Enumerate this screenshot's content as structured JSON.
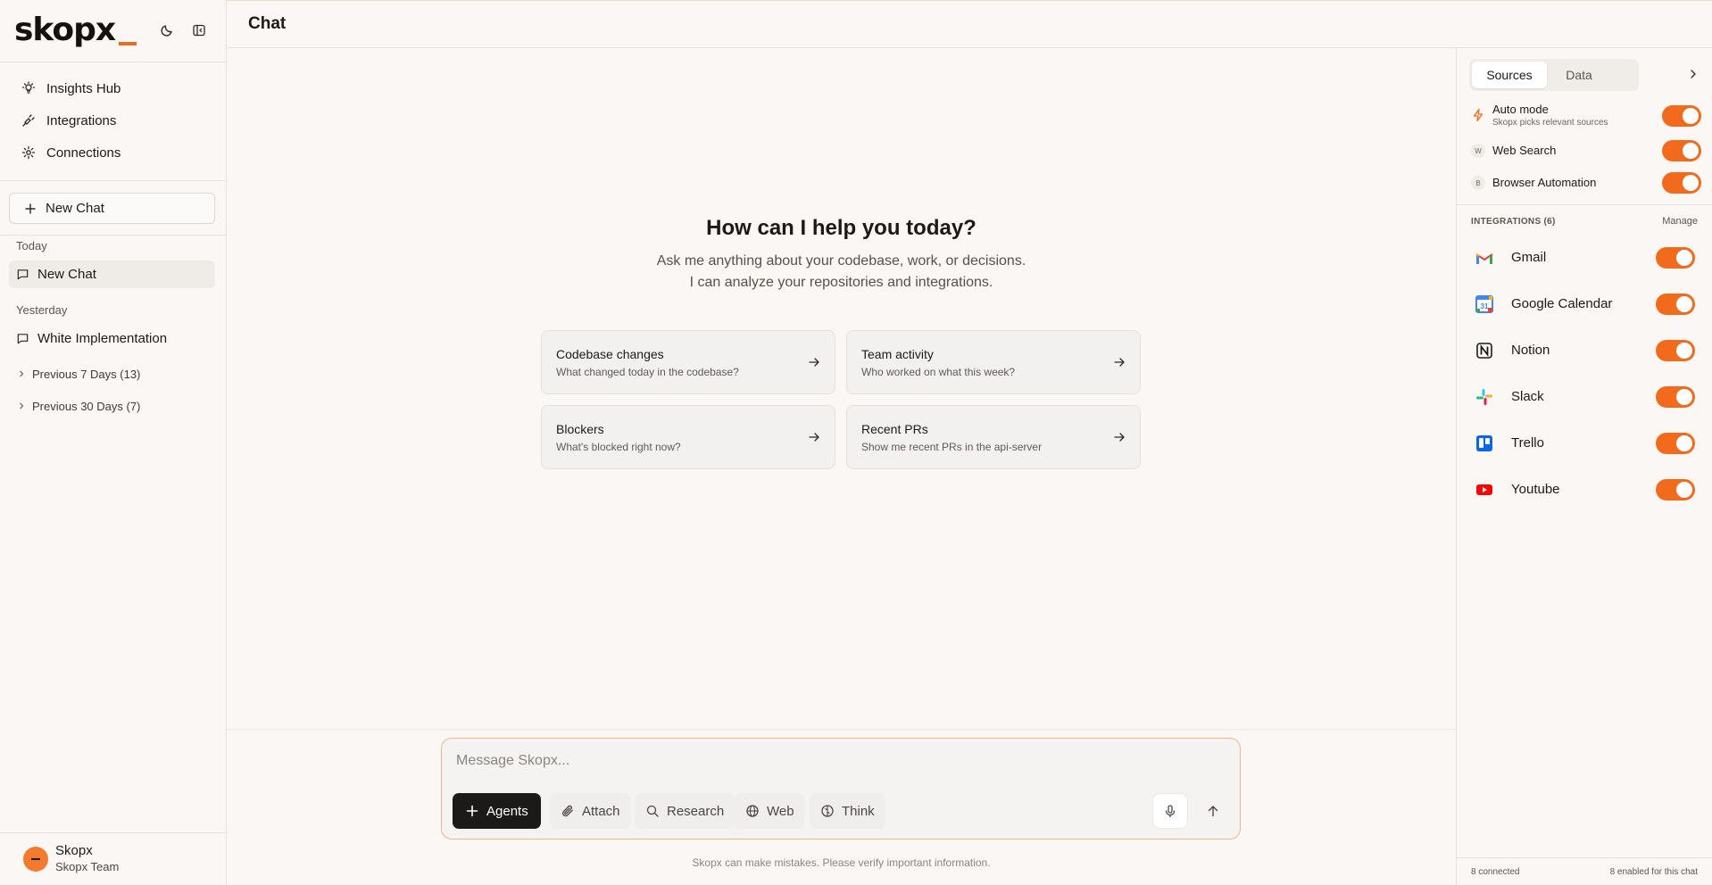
{
  "brand": {
    "name": "skopx"
  },
  "sidebar": {
    "nav": [
      {
        "label": "Insights Hub",
        "icon": "lightbulb-icon"
      },
      {
        "label": "Integrations",
        "icon": "plug-icon"
      },
      {
        "label": "Connections",
        "icon": "gear-icon"
      }
    ],
    "new_chat_label": "New Chat",
    "today_label": "Today",
    "today_items": [
      {
        "label": "New Chat"
      }
    ],
    "yesterday_label": "Yesterday",
    "yesterday_items": [
      {
        "label": "White Implementation"
      }
    ],
    "collapsed_groups": [
      {
        "label": "Previous 7 Days (13)"
      },
      {
        "label": "Previous 30 Days (7)"
      }
    ],
    "user": {
      "name": "Skopx",
      "team": "Skopx Team"
    }
  },
  "header": {
    "title": "Chat"
  },
  "main": {
    "hero_title": "How can I help you today?",
    "hero_line1": "Ask me anything about your codebase, work, or decisions.",
    "hero_line2": "I can analyze your repositories and integrations.",
    "cards": [
      {
        "title": "Codebase changes",
        "sub": "What changed today in the codebase?"
      },
      {
        "title": "Team activity",
        "sub": "Who worked on what this week?"
      },
      {
        "title": "Blockers",
        "sub": "What's blocked right now?"
      },
      {
        "title": "Recent PRs",
        "sub": "Show me recent PRs in the api-server"
      }
    ],
    "composer": {
      "placeholder": "Message Skopx...",
      "tools": [
        {
          "label": "Agents",
          "icon": "plus-icon"
        },
        {
          "label": "Attach",
          "icon": "paperclip-icon"
        },
        {
          "label": "Research",
          "icon": "search-icon"
        },
        {
          "label": "Web",
          "icon": "globe-icon"
        },
        {
          "label": "Think",
          "icon": "brain-icon"
        }
      ]
    },
    "disclaimer": "Skopx can make mistakes. Please verify important information."
  },
  "panel": {
    "tabs": [
      "Sources",
      "Data"
    ],
    "active_tab": "Sources",
    "sources": [
      {
        "label": "Auto mode",
        "sub": "Skopx picks relevant sources",
        "enabled": true,
        "icon": "lightning-icon"
      },
      {
        "label": "Web Search",
        "badge": "W",
        "enabled": true
      },
      {
        "label": "Browser Automation",
        "badge": "B",
        "enabled": true
      }
    ],
    "integrations_header": "INTEGRATIONS (6)",
    "manage_label": "Manage",
    "integrations": [
      {
        "label": "Gmail",
        "icon": "gmail-icon",
        "enabled": true
      },
      {
        "label": "Google Calendar",
        "icon": "google-calendar-icon",
        "enabled": true
      },
      {
        "label": "Notion",
        "icon": "notion-icon",
        "enabled": true
      },
      {
        "label": "Slack",
        "icon": "slack-icon",
        "enabled": true
      },
      {
        "label": "Trello",
        "icon": "trello-icon",
        "enabled": true
      },
      {
        "label": "Youtube",
        "icon": "youtube-icon",
        "enabled": true
      }
    ],
    "calendar_day": "31",
    "footer_connected": "8 connected",
    "footer_enabled": "8 enabled for this chat"
  },
  "colors": {
    "accent": "#f26b1d",
    "background": "#faf7f4",
    "border": "#e6e1dc",
    "dark_button": "#1c1a18"
  }
}
